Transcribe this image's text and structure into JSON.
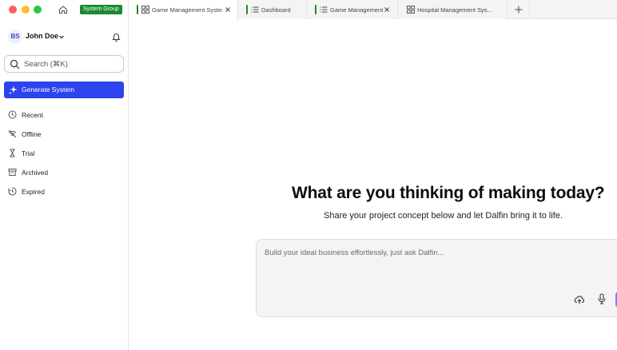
{
  "window": {
    "group_badge": "System Group"
  },
  "user": {
    "initials": "BS",
    "name": "John Doe"
  },
  "search": {
    "placeholder": "Search (⌘K)"
  },
  "sidebar": {
    "generate_label": "Generate System",
    "items": [
      {
        "label": "Recent",
        "icon": "clock-icon"
      },
      {
        "label": "Offline",
        "icon": "wifi-off-icon"
      },
      {
        "label": "Trial",
        "icon": "hourglass-icon"
      },
      {
        "label": "Archived",
        "icon": "archive-icon"
      },
      {
        "label": "Expired",
        "icon": "clock-expired-icon"
      }
    ]
  },
  "tabs": [
    {
      "label": "Game Management System",
      "icon": "grid-icon",
      "active": true,
      "accent": "#1a8a32"
    },
    {
      "label": "Dashboard",
      "icon": "list-icon",
      "active": false,
      "accent": "#1a8a32"
    },
    {
      "label": "Game Management",
      "icon": "list-icon",
      "active": false,
      "accent": "#1a8a32"
    },
    {
      "label": "Hospital Management Sys...",
      "icon": "grid-icon",
      "active": false
    }
  ],
  "main": {
    "headline": "What are you thinking of making today?",
    "subheadline": "Share your project concept below and let Dalfin bring it to life.",
    "composer_placeholder": "Build your ideal business effortlessly, just ask Dalfin..."
  },
  "colors": {
    "primary": "#2b44ee",
    "brand_green": "#1a8a32"
  }
}
